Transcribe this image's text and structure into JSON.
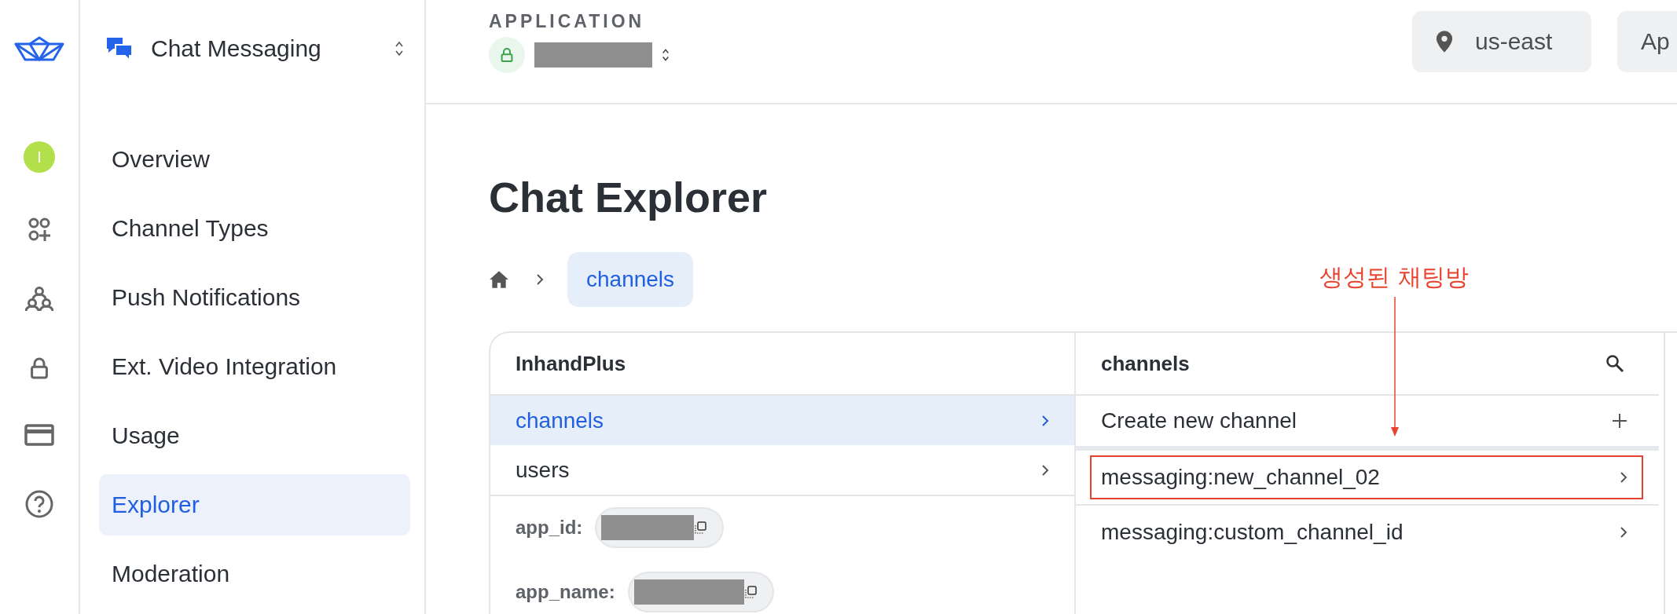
{
  "rail": {
    "avatar": "I"
  },
  "product": {
    "name": "Chat Messaging"
  },
  "nav": [
    {
      "label": "Overview",
      "selected": false
    },
    {
      "label": "Channel Types",
      "selected": false
    },
    {
      "label": "Push Notifications",
      "selected": false
    },
    {
      "label": "Ext. Video Integration",
      "selected": false
    },
    {
      "label": "Usage",
      "selected": false
    },
    {
      "label": "Explorer",
      "selected": true
    },
    {
      "label": "Moderation",
      "selected": false
    }
  ],
  "header": {
    "label": "APPLICATION",
    "region": "us-east",
    "button_2": "Ap"
  },
  "page": {
    "title": "Chat Explorer",
    "breadcrumb": [
      {
        "label": "channels",
        "selected": true
      }
    ]
  },
  "explorer": {
    "left": {
      "title": "InhandPlus",
      "items": [
        {
          "label": "channels",
          "selected": true
        },
        {
          "label": "users",
          "selected": false
        }
      ],
      "fields": [
        {
          "label": "app_id:"
        },
        {
          "label": "app_name:"
        }
      ]
    },
    "right": {
      "title": "channels",
      "create": "Create new channel",
      "items": [
        {
          "label": "messaging:new_channel_02",
          "highlighted": true
        },
        {
          "label": "messaging:custom_channel_id",
          "highlighted": false
        }
      ]
    }
  },
  "annotation": {
    "text": "생성된 채팅방"
  }
}
